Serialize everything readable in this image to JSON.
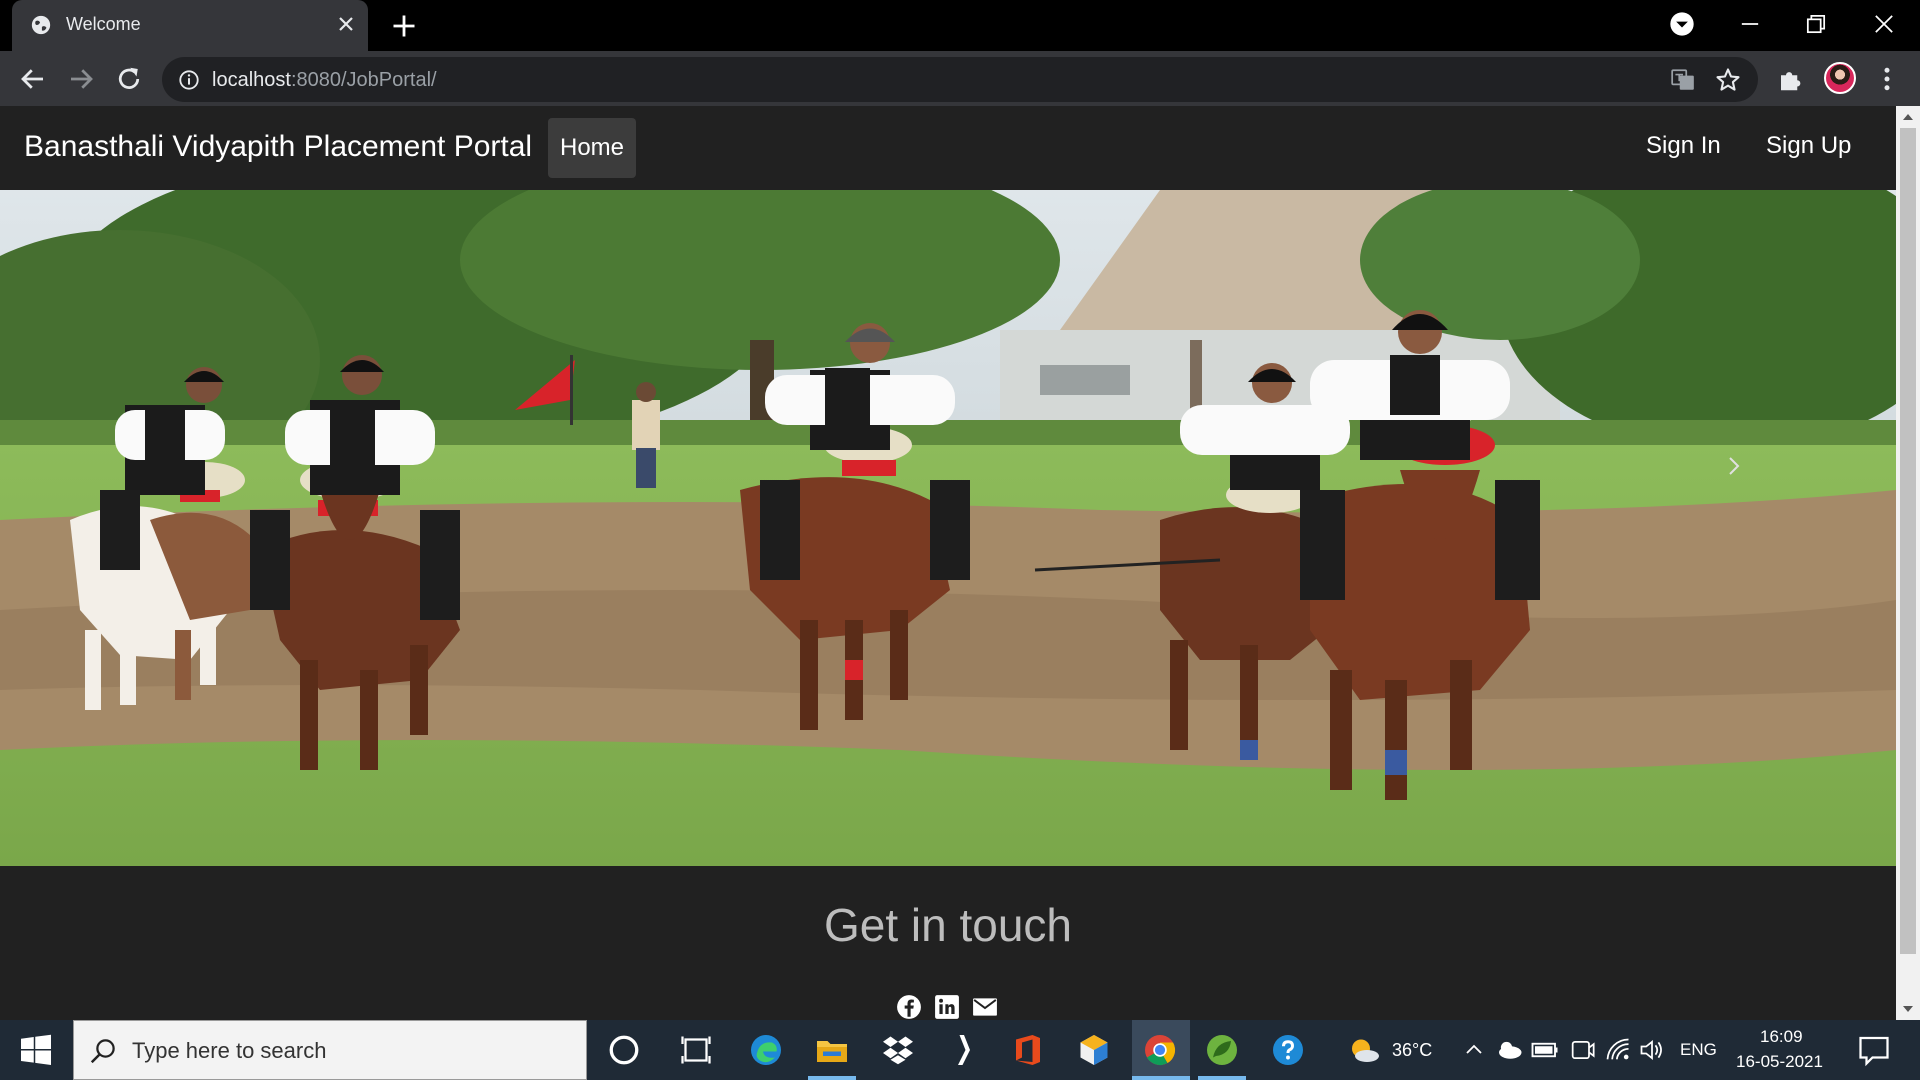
{
  "browser": {
    "tab_title": "Welcome",
    "url_host": "localhost",
    "url_rest": ":8080/JobPortal/"
  },
  "navbar": {
    "brand": "Banasthali Vidyapith Placement Portal",
    "home": "Home",
    "sign_in": "Sign In",
    "sign_up": "Sign Up"
  },
  "footer": {
    "heading": "Get in touch",
    "links": [
      "facebook-icon",
      "linkedin-icon",
      "mail-icon"
    ]
  },
  "taskbar": {
    "search_placeholder": "Type here to search",
    "weather": "36°C",
    "language": "ENG",
    "time": "16:09",
    "date": "16-05-2021"
  },
  "colors": {
    "nav_bg": "#212121",
    "footer_heading": "#bdbdbd",
    "taskbar_bg": "#1f2a36"
  }
}
